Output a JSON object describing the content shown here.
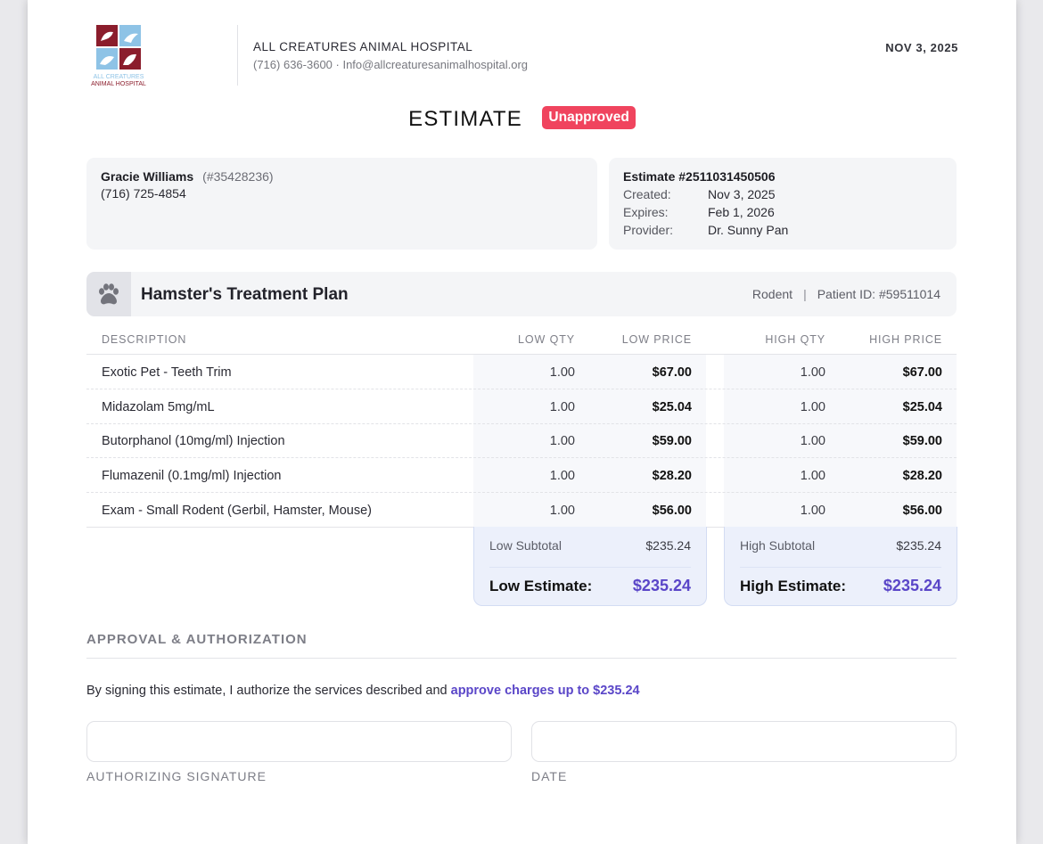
{
  "header": {
    "logo_text": [
      "ALL CREATURES",
      "ANIMAL HOSPITAL"
    ],
    "hospital_name": "ALL CREATURES ANIMAL HOSPITAL",
    "contact": "(716) 636-3600 · Info@allcreaturesanimalhospital.org",
    "date": "NOV 3, 2025"
  },
  "title": {
    "label": "ESTIMATE",
    "status": "Unapproved"
  },
  "client": {
    "name": "Gracie Williams",
    "id": "(#35428236)",
    "phone": "(716) 725-4854"
  },
  "estimate": {
    "number": "Estimate #2511031450506",
    "created_label": "Created:",
    "created": "Nov 3, 2025",
    "expires_label": "Expires:",
    "expires": "Feb 1, 2026",
    "provider_label": "Provider:",
    "provider": "Dr. Sunny Pan"
  },
  "plan": {
    "icon": "paw-icon",
    "title": "Hamster's Treatment Plan",
    "species": "Rodent",
    "separator": "|",
    "patient_id": "Patient ID: #59511014"
  },
  "table": {
    "headers": [
      "DESCRIPTION",
      "LOW QTY",
      "LOW PRICE",
      "HIGH QTY",
      "HIGH PRICE"
    ],
    "rows": [
      {
        "desc": "Exotic Pet - Teeth Trim",
        "low_qty": "1.00",
        "low_price": "$67.00",
        "high_qty": "1.00",
        "high_price": "$67.00"
      },
      {
        "desc": "Midazolam 5mg/mL",
        "low_qty": "1.00",
        "low_price": "$25.04",
        "high_qty": "1.00",
        "high_price": "$25.04"
      },
      {
        "desc": "Butorphanol (10mg/ml) Injection",
        "low_qty": "1.00",
        "low_price": "$59.00",
        "high_qty": "1.00",
        "high_price": "$59.00"
      },
      {
        "desc": "Flumazenil (0.1mg/ml) Injection",
        "low_qty": "1.00",
        "low_price": "$28.20",
        "high_qty": "1.00",
        "high_price": "$28.20"
      },
      {
        "desc": "Exam - Small Rodent (Gerbil, Hamster, Mouse)",
        "low_qty": "1.00",
        "low_price": "$56.00",
        "high_qty": "1.00",
        "high_price": "$56.00"
      }
    ]
  },
  "totals": {
    "low_subtotal_label": "Low Subtotal",
    "low_subtotal": "$235.24",
    "low_estimate_label": "Low Estimate:",
    "low_estimate": "$235.24",
    "high_subtotal_label": "High Subtotal",
    "high_subtotal": "$235.24",
    "high_estimate_label": "High Estimate:",
    "high_estimate": "$235.24"
  },
  "approval": {
    "section_title": "APPROVAL & AUTHORIZATION",
    "text": "By signing this estimate, I authorize the services described and ",
    "text_bold": "approve charges up to $235.24",
    "signature_label": "AUTHORIZING SIGNATURE",
    "date_label": "DATE"
  },
  "colors": {
    "status_badge": "#f0445e",
    "accent": "#5a46c8",
    "logo_maroon": "#8b1d2c",
    "logo_blue": "#8ec3e6"
  }
}
